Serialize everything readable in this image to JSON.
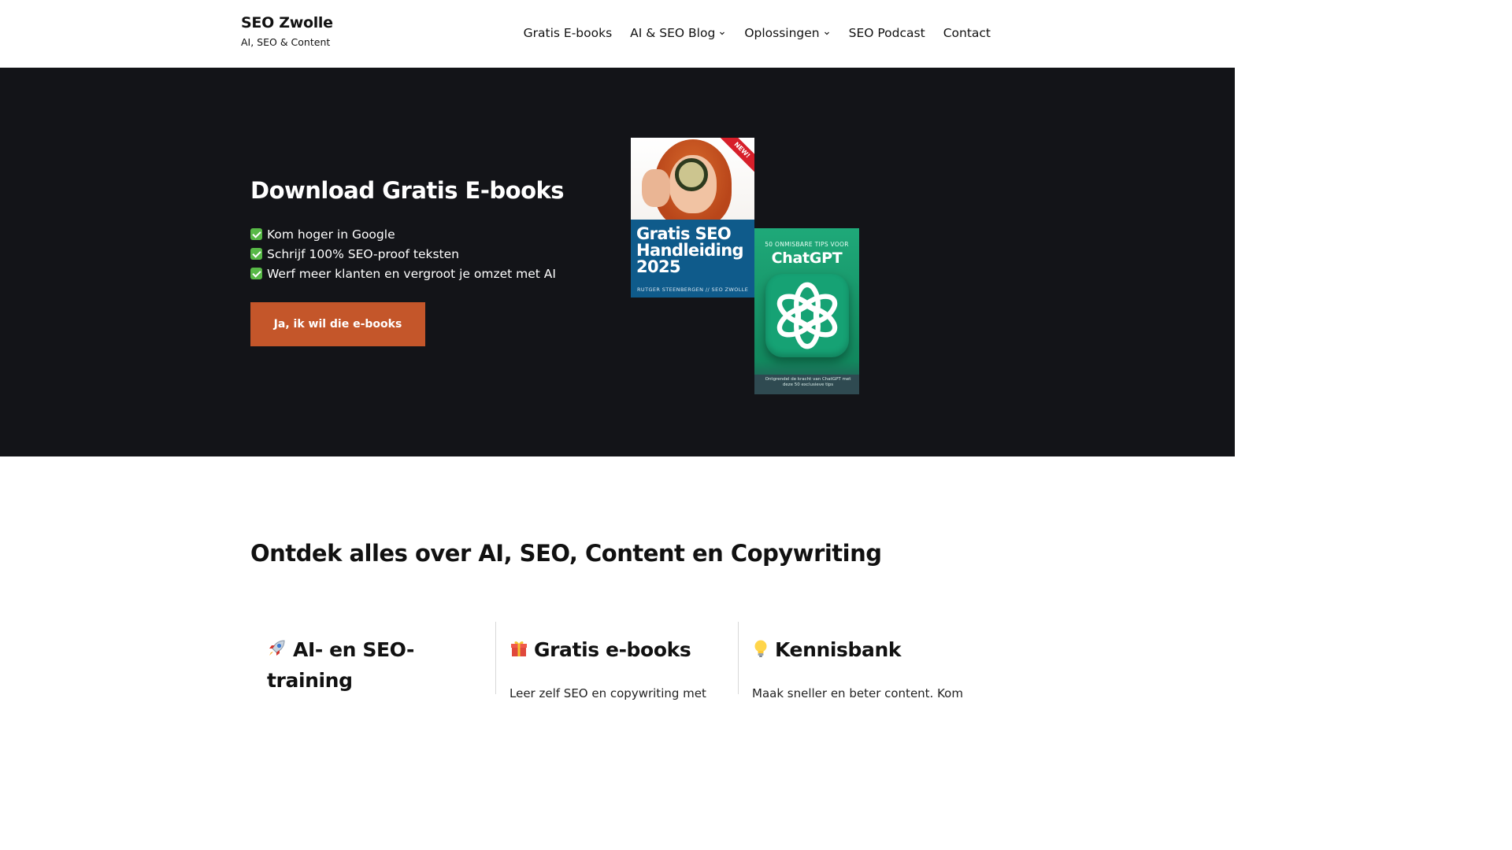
{
  "header": {
    "site_title": "SEO Zwolle",
    "tagline": "AI, SEO & Content",
    "nav": [
      {
        "label": "Gratis E-books",
        "has_dropdown": false
      },
      {
        "label": "AI & SEO Blog",
        "has_dropdown": true
      },
      {
        "label": "Oplossingen",
        "has_dropdown": true
      },
      {
        "label": "SEO Podcast",
        "has_dropdown": false
      },
      {
        "label": "Contact",
        "has_dropdown": false
      }
    ]
  },
  "hero": {
    "title": "Download Gratis E-books",
    "bullets": [
      "Kom hoger in Google",
      "Schrijf 100% SEO-proof teksten",
      "Werf meer klanten en vergroot je omzet met AI"
    ],
    "cta_label": "Ja, ik wil die e-books",
    "books": {
      "seo": {
        "badge": "NEW!",
        "title": "Gratis SEO\nHandleiding\n2025",
        "author": "RUTGER STEENBERGEN // SEO ZWOLLE"
      },
      "chatgpt": {
        "kicker": "50 ONMISBARE TIPS VOOR",
        "title": "ChatGPT",
        "subtitle": "Ontgrendel de kracht van ChatGPT met deze 50 exclusieve tips"
      }
    }
  },
  "content": {
    "section_title": "Ontdek alles over AI, SEO, Content en Copywriting",
    "features": [
      {
        "icon": "rocket-icon",
        "title": "AI- en SEO-training",
        "text": ""
      },
      {
        "icon": "gift-icon",
        "title": "Gratis e-books",
        "text": "Leer zelf SEO en copywriting met"
      },
      {
        "icon": "lightbulb-icon",
        "title": "Kennisbank",
        "text": "Maak sneller en beter content. Kom"
      }
    ]
  },
  "colors": {
    "hero_background": "#131418",
    "cta_background": "#c4562a",
    "seo_book_blue": "#0f5b8b",
    "chatgpt_book_green": "#1fa979",
    "check_green": "#58b947"
  }
}
